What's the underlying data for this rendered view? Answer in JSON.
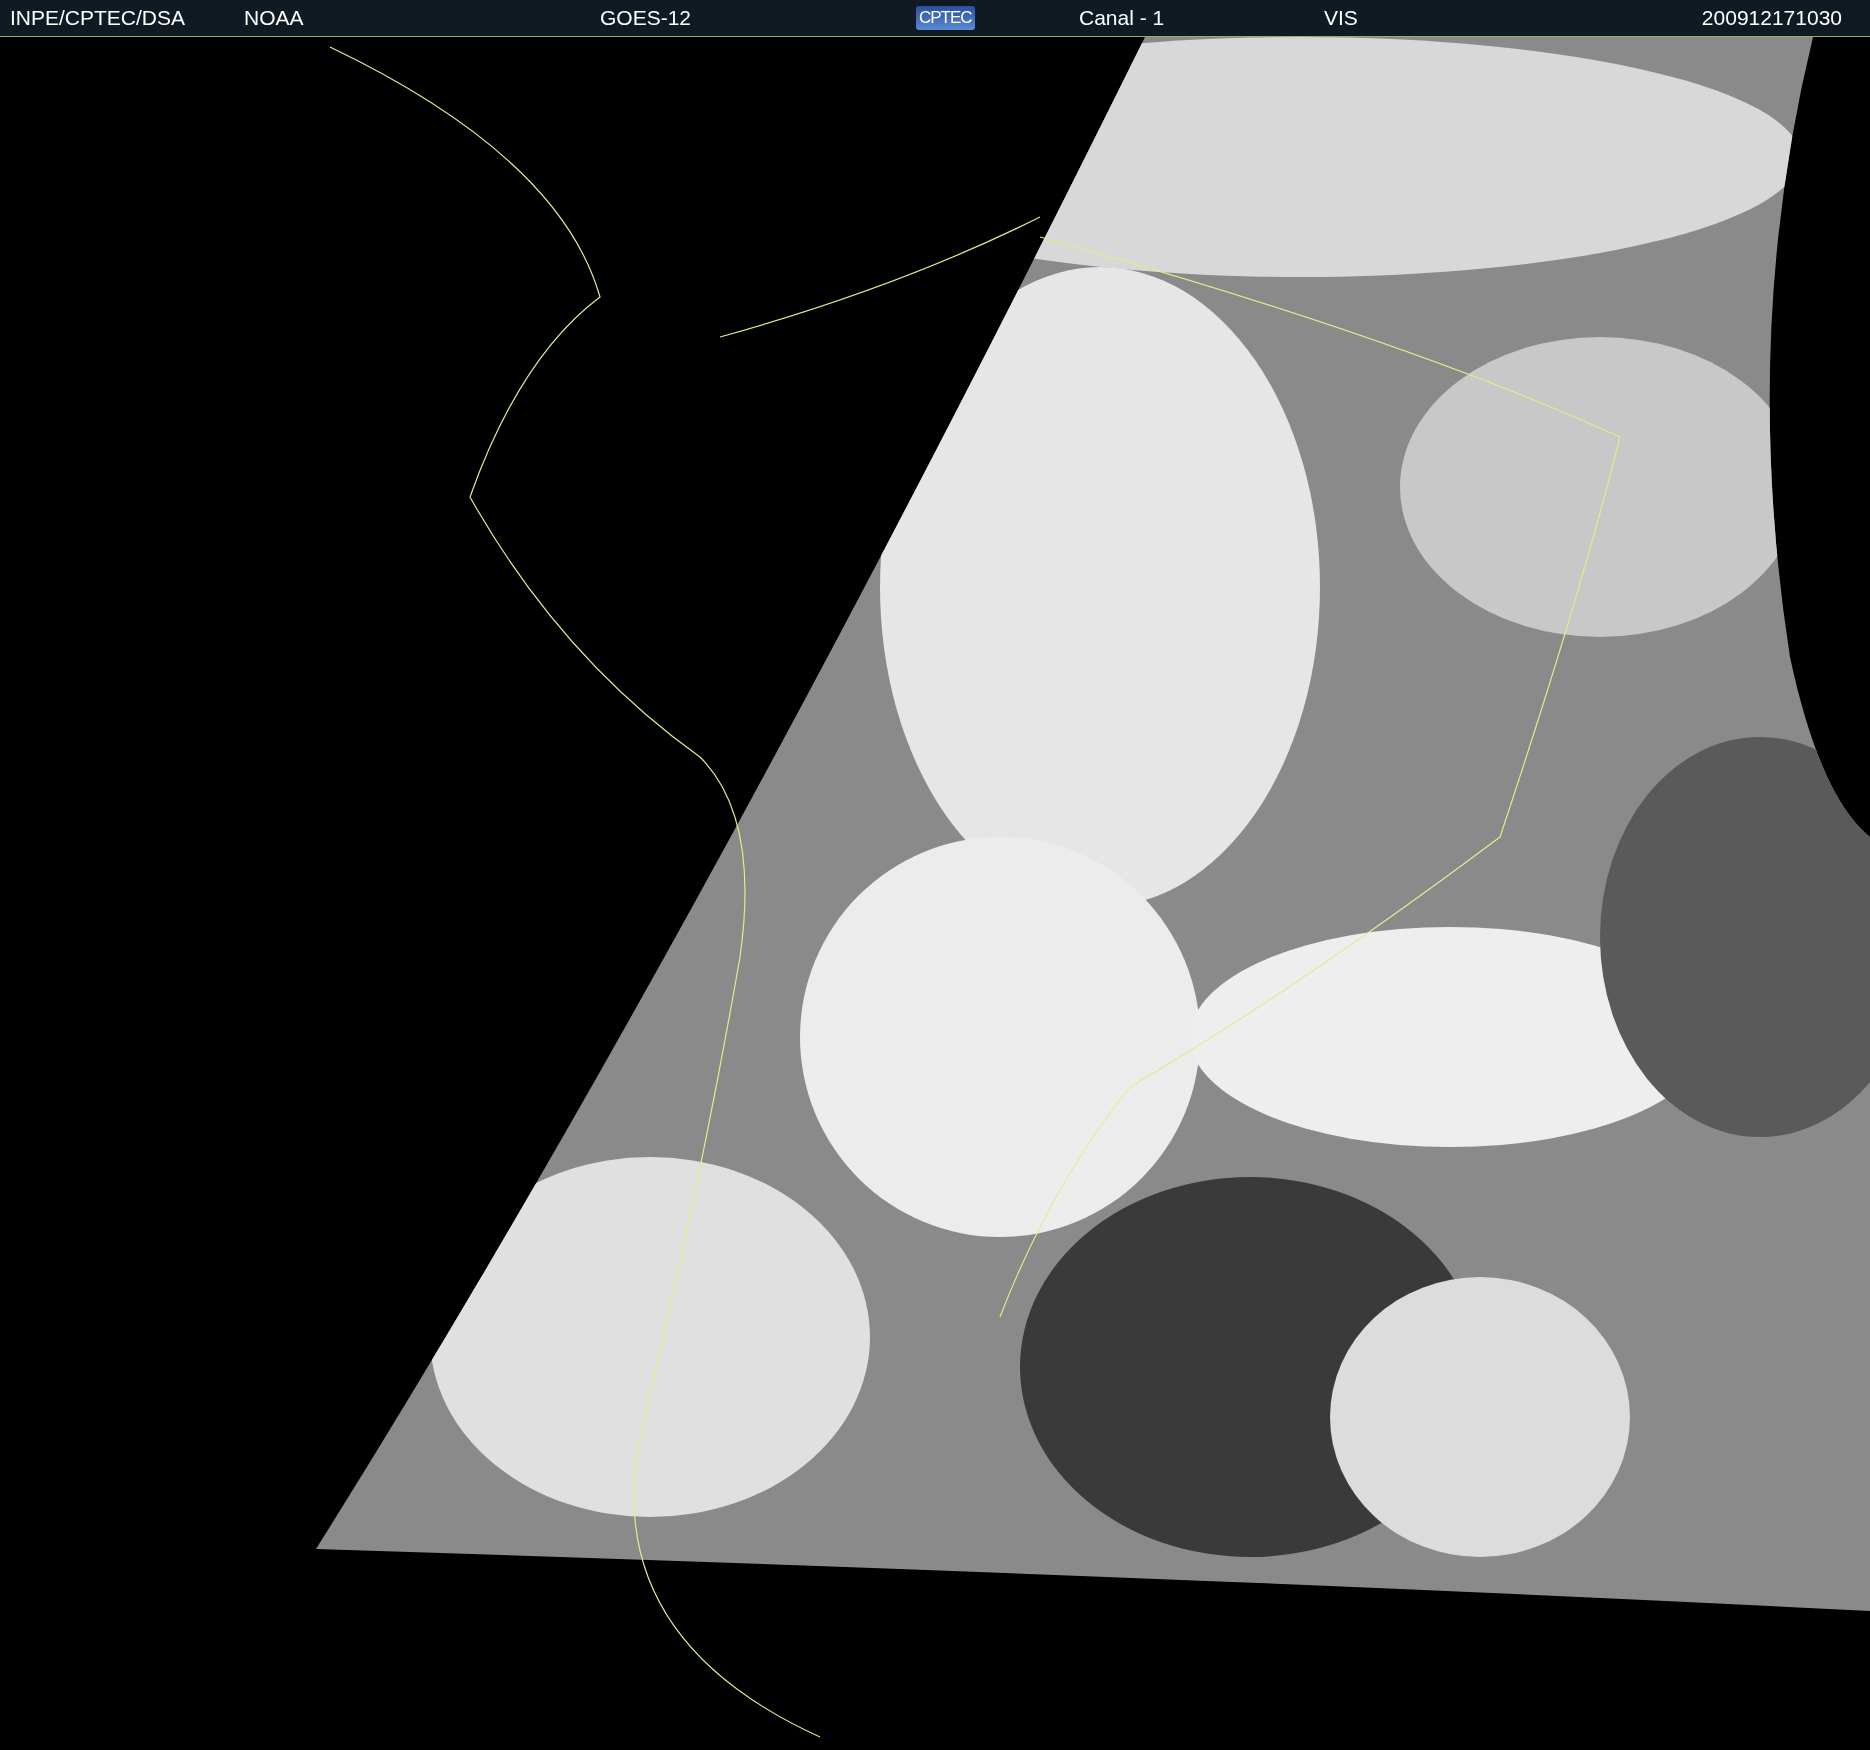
{
  "header": {
    "source": "INPE/CPTEC/DSA",
    "agency": "NOAA",
    "satellite": "GOES-12",
    "logo": "CPTEC",
    "channel": "Canal - 1",
    "band": "VIS",
    "timestamp": "200912171030"
  }
}
